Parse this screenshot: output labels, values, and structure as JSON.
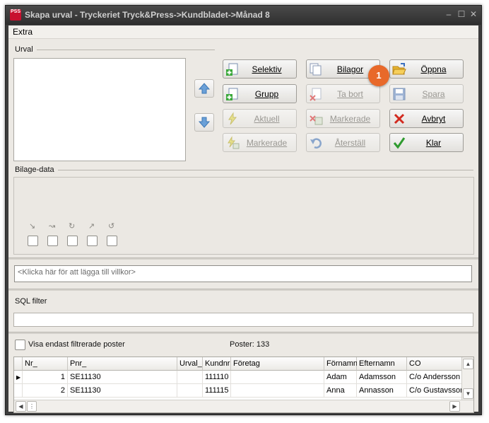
{
  "window": {
    "title": "Skapa urval - Tryckeriet Tryck&Press->Kundbladet->Månad 8",
    "app_icon": "PSS"
  },
  "menu": {
    "extra": "Extra"
  },
  "urval": {
    "label": "Urval"
  },
  "buttons": {
    "selektiv": "Selektiv",
    "grupp": "Grupp",
    "aktuell": "Aktuell",
    "markerade_left": "Markerade",
    "bilagor": "Bilagor",
    "ta_bort": "Ta bort",
    "markerade_mid": "Markerade",
    "aterstall": "Återställ",
    "oppna": "Öppna",
    "spara": "Spara",
    "avbryt": "Avbryt",
    "klar": "Klar"
  },
  "badge": "1",
  "bilage": {
    "label": "Bilage-data"
  },
  "villkor": {
    "placeholder": "<Klicka här för att lägga till villkor>"
  },
  "sql": {
    "label": "SQL filter"
  },
  "filter": {
    "checkbox_label": "Visa endast filtrerade poster",
    "poster": "Poster: 133"
  },
  "grid": {
    "columns": [
      "Nr_",
      "Pnr_",
      "Urval_",
      "Kundnr",
      "Företag",
      "Förnamn",
      "Efternamn",
      "CO"
    ],
    "rows": [
      {
        "nr": "1",
        "pnr": "SE11130",
        "urval": "",
        "kundnr": "111110",
        "foretag": "",
        "fornamn": "Adam",
        "efternamn": "Adamsson",
        "co": "C/o Andersson"
      },
      {
        "nr": "2",
        "pnr": "SE11130",
        "urval": "",
        "kundnr": "111115",
        "foretag": "",
        "fornamn": "Anna",
        "efternamn": "Annasson",
        "co": "C/o Gustavsson"
      }
    ]
  }
}
